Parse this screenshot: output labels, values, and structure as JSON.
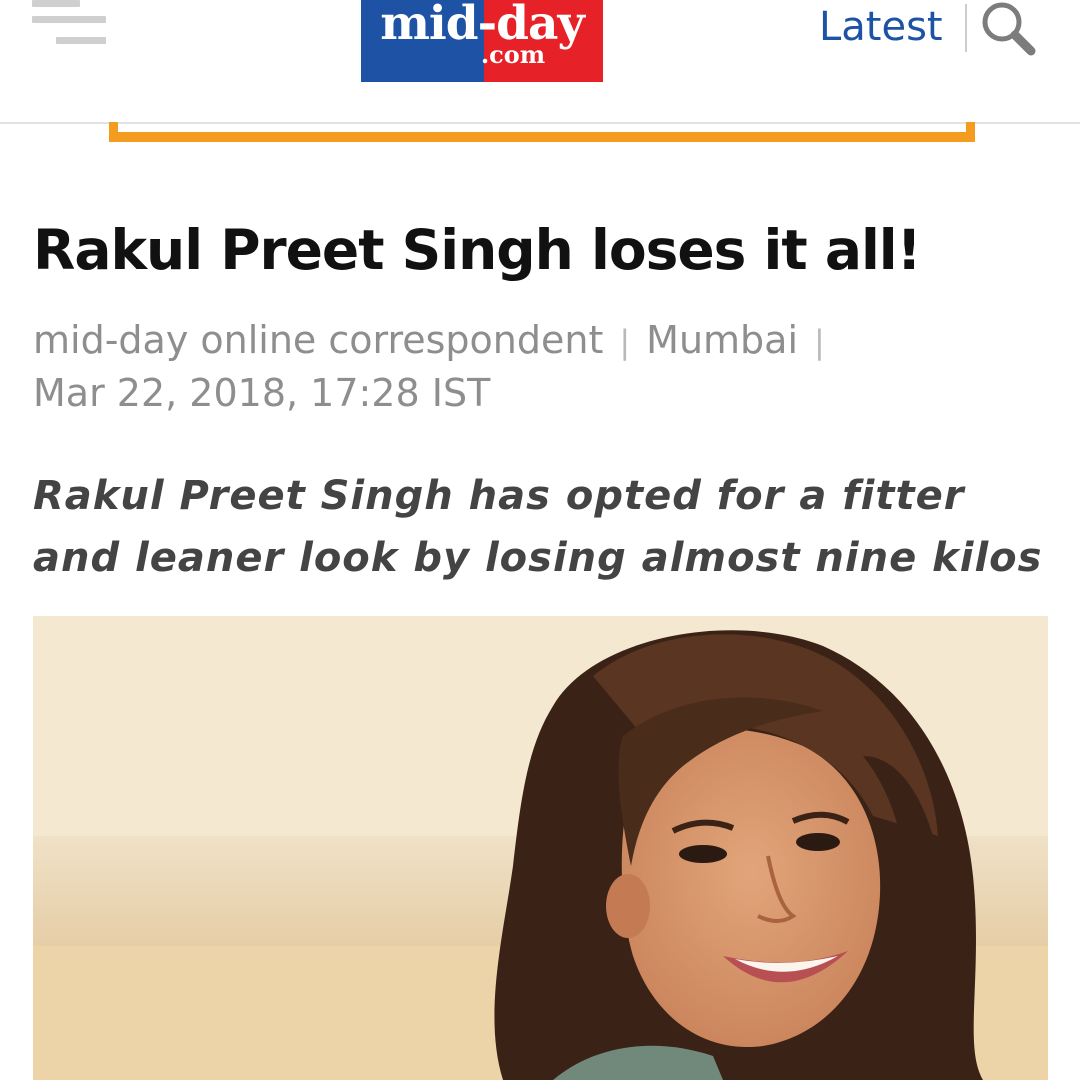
{
  "header": {
    "logo": {
      "main_text": "mid-day",
      "sub_text": ".com",
      "colors": {
        "left": "#1d52a5",
        "right": "#e62128"
      }
    },
    "latest_label": "Latest",
    "icons": {
      "menu": "hamburger-menu-icon",
      "search": "magnifier-search-icon"
    },
    "accent_color": "#f39c1f"
  },
  "article": {
    "headline": "Rakul Preet Singh loses it all!",
    "byline": {
      "author": "mid-day online correspondent",
      "location": "Mumbai",
      "datetime": "Mar 22, 2018, 17:28 IST"
    },
    "standfirst": "Rakul Preet Singh has opted for a fitter and leaner look by losing almost nine kilos"
  }
}
